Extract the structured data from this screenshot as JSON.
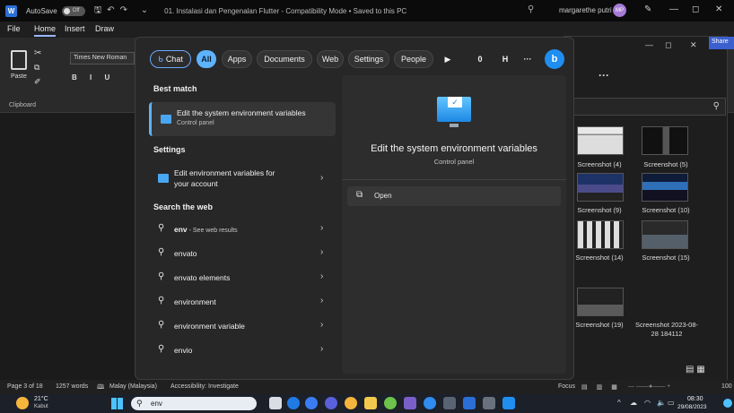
{
  "word": {
    "icon_letter": "W",
    "autosave_label": "AutoSave",
    "autosave_state": "Off",
    "doc_title": "01. Instalasi dan Pengenalan Flutter  -  Compatibility Mode  •  Saved to this PC",
    "user_name": "margarethe putri",
    "user_initials": "MP",
    "ribbon_tabs": [
      "File",
      "Home",
      "Insert",
      "Draw"
    ],
    "active_tab": "Home",
    "paste_label": "Paste",
    "font_name": "Times New Roman",
    "clipboard_label": "Clipboard",
    "format_buttons": "B  I  U",
    "share_label": "Share"
  },
  "search_panel": {
    "chips": [
      "Chat",
      "All",
      "Apps",
      "Documents",
      "Web",
      "Settings",
      "People"
    ],
    "chip_extra": [
      "▶",
      "0 ",
      "H",
      "···"
    ],
    "best_match_heading": "Best match",
    "best_match": {
      "title": "Edit the system environment variables",
      "subtitle": "Control panel"
    },
    "settings_heading": "Settings",
    "settings_item": {
      "line1": "Edit environment variables for",
      "line2": "your account"
    },
    "web_heading": "Search the web",
    "web_results": [
      {
        "query": "env",
        "suffix": " - See web results"
      },
      {
        "query": "envato",
        "suffix": ""
      },
      {
        "query": "envato elements",
        "suffix": ""
      },
      {
        "query": "environment",
        "suffix": ""
      },
      {
        "query": "environment variable",
        "suffix": ""
      },
      {
        "query": "envio",
        "suffix": ""
      }
    ],
    "preview": {
      "title": "Edit the system environment variables",
      "subtitle": "Control panel",
      "open_label": "Open"
    }
  },
  "explorer": {
    "more_label": "···",
    "thumbnails": [
      {
        "label": "Screenshot (4)"
      },
      {
        "label": "Screenshot (5)"
      },
      {
        "label": "Screenshot (9)"
      },
      {
        "label": "Screenshot (10)"
      },
      {
        "label": "Screenshot (14)"
      },
      {
        "label": "Screenshot (15)"
      },
      {
        "label": "Screenshot (19)"
      },
      {
        "label": "Screenshot 2023-08-28 184112"
      }
    ]
  },
  "statusbar": {
    "page": "Page 3 of 18",
    "words": "1257 words",
    "language": "Malay (Malaysia)",
    "accessibility": "Accessibility: Investigate",
    "focus": "Focus",
    "zoom": "100"
  },
  "taskbar": {
    "temperature": "21°C",
    "weather": "Kabut",
    "search_text": "env",
    "time": "08:30",
    "date": "29/08/2023"
  },
  "colors": {
    "accent": "#5db3ff",
    "panel_bg": "#272727",
    "word_blue": "#2b6fd6"
  }
}
